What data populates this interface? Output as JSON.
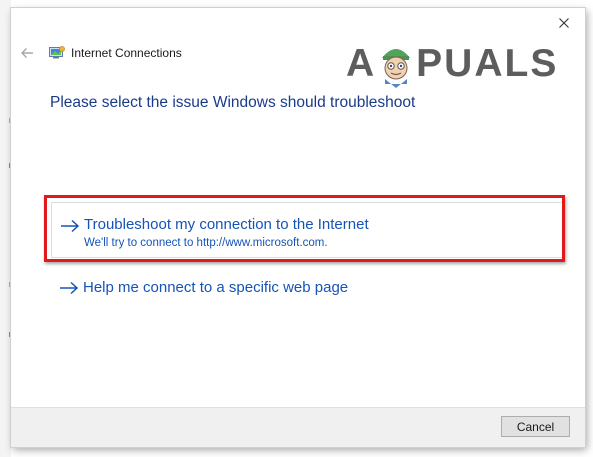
{
  "window": {
    "title": "Internet Connections",
    "close_icon": "close-icon",
    "back_icon": "back-arrow-icon",
    "app_icon": "network-connection-icon"
  },
  "watermark": {
    "text_left": "A",
    "text_right": "PUALS"
  },
  "heading": "Please select the issue Windows should troubleshoot",
  "options": [
    {
      "title": "Troubleshoot my connection to the Internet",
      "description": "We'll try to connect to http://www.microsoft.com.",
      "icon": "arrow-right-icon",
      "highlighted": true
    },
    {
      "title": "Help me connect to a specific web page",
      "icon": "arrow-right-icon",
      "highlighted": false
    }
  ],
  "footer": {
    "cancel_label": "Cancel"
  },
  "colors": {
    "link_blue": "#1653b8",
    "heading_blue": "#1a3a8a",
    "highlight_red": "#e0191b"
  }
}
